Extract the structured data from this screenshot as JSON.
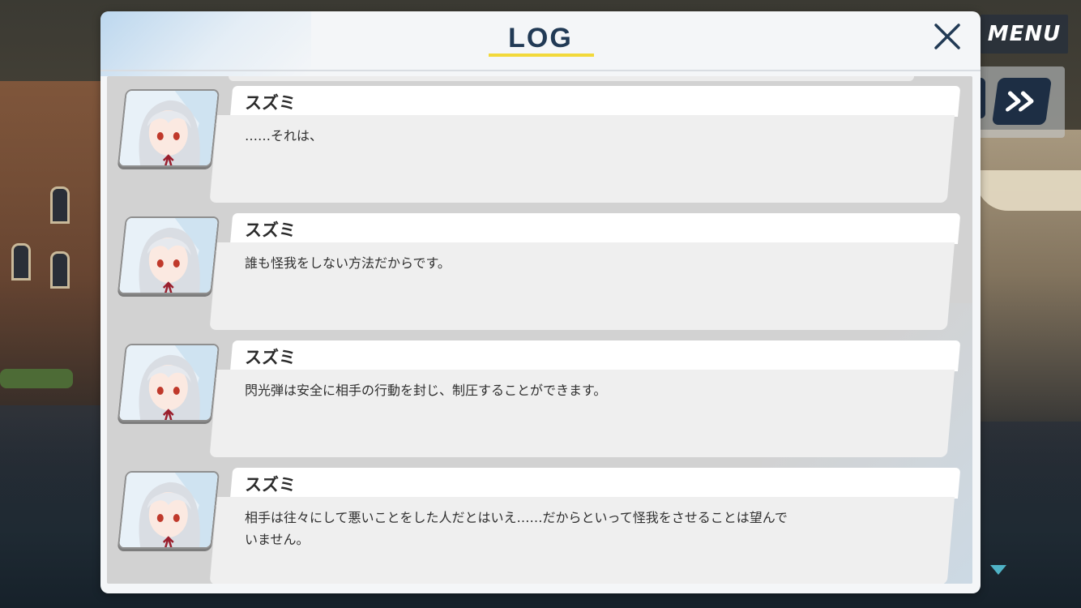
{
  "header": {
    "title": "LOG"
  },
  "side_controls": {
    "menu_label": "MENU"
  },
  "entries": [
    {
      "speaker": "スズミ",
      "text": "……それは、"
    },
    {
      "speaker": "スズミ",
      "text": "誰も怪我をしない方法だからです。"
    },
    {
      "speaker": "スズミ",
      "text": "閃光弾は安全に相手の行動を封じ、制圧することができます。"
    },
    {
      "speaker": "スズミ",
      "text": "相手は往々にして悪いことをした人だとはいえ……だからといって怪我をさせることは望んで\nいません。"
    }
  ],
  "colors": {
    "title": "#213a55",
    "title_underline": "#f2d93a",
    "scroll_indicator": "#4fb3c6"
  },
  "icons": [
    "close-icon",
    "skip-forward-icon",
    "chevron-down-icon"
  ]
}
